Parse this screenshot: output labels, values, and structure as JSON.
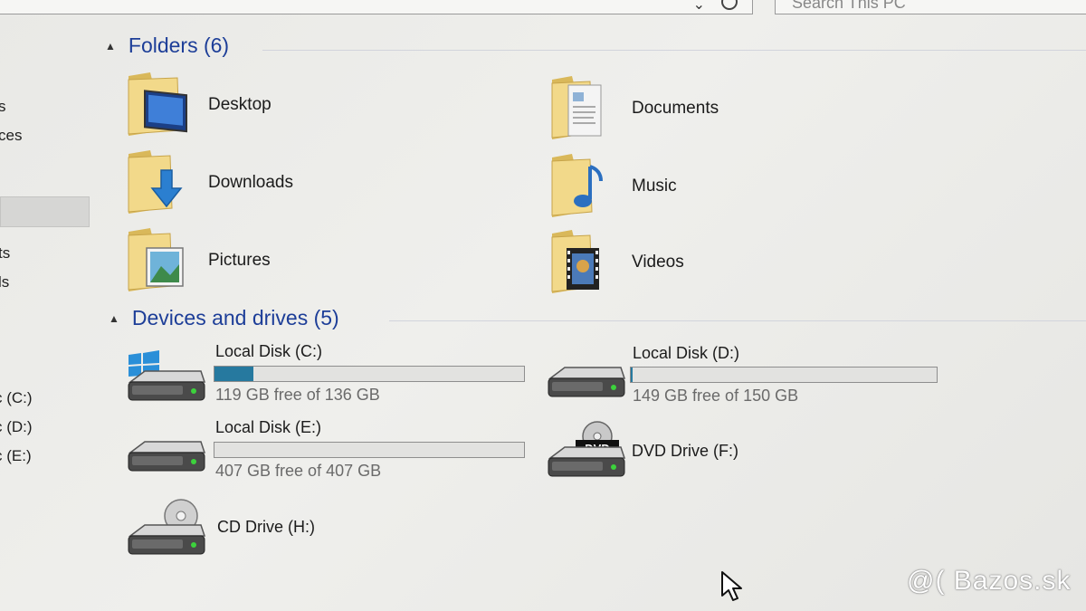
{
  "toolbar": {
    "address_chevron": "⌄",
    "search_placeholder": "Search This PC"
  },
  "nav": {
    "items": [
      {
        "label": "s"
      },
      {
        "label": "ces"
      },
      {
        "label": "ts"
      },
      {
        "label": "ls"
      },
      {
        "label": "c (C:)"
      },
      {
        "label": "c (D:)"
      },
      {
        "label": "c (E:)"
      }
    ]
  },
  "folders": {
    "title": "Folders (6)",
    "items": [
      {
        "label": "Desktop",
        "icon": "desktop-folder-icon"
      },
      {
        "label": "Documents",
        "icon": "documents-folder-icon"
      },
      {
        "label": "Downloads",
        "icon": "downloads-folder-icon"
      },
      {
        "label": "Music",
        "icon": "music-folder-icon"
      },
      {
        "label": "Pictures",
        "icon": "pictures-folder-icon"
      },
      {
        "label": "Videos",
        "icon": "videos-folder-icon"
      }
    ]
  },
  "devices": {
    "title": "Devices and drives (5)",
    "drives": [
      {
        "name": "Local Disk (C:)",
        "free_text": "119 GB free of 136 GB",
        "used_fraction": 0.125,
        "icon": "system-drive-icon"
      },
      {
        "name": "Local Disk (D:)",
        "free_text": "149 GB free of 150 GB",
        "used_fraction": 0.0067,
        "icon": "hard-drive-icon"
      },
      {
        "name": "Local Disk (E:)",
        "free_text": "407 GB free of 407 GB",
        "used_fraction": 0.0,
        "icon": "hard-drive-icon"
      },
      {
        "name": "DVD Drive (F:)",
        "icon": "dvd-drive-icon",
        "badge": "DVD"
      },
      {
        "name": "CD Drive (H:)",
        "icon": "cd-drive-icon"
      }
    ]
  },
  "colors": {
    "header_blue": "#1d3e98",
    "bar_fill": "#26799f",
    "folder_yellow": "#f2d98a"
  },
  "watermark": "@( Bazos.sk"
}
